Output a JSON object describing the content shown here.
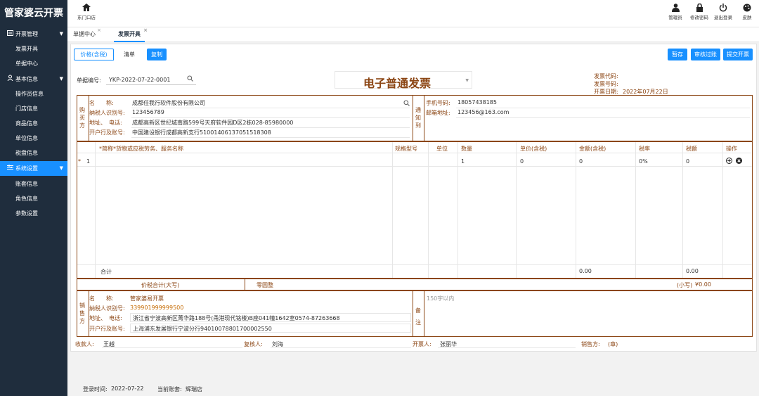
{
  "app": {
    "title": "管家婆云开票"
  },
  "sidebar": {
    "groups": [
      {
        "label": "开票管理",
        "icon": "invoice-icon",
        "items": [
          "发票开具",
          "单据中心"
        ]
      },
      {
        "label": "基本信息",
        "icon": "user-icon",
        "items": [
          "操作员信息",
          "门店信息",
          "商品信息",
          "单位信息",
          "税盘信息"
        ]
      },
      {
        "label": "系统设置",
        "icon": "settings-icon",
        "items": [
          "账套信息",
          "角色信息",
          "参数设置"
        ]
      }
    ]
  },
  "header": {
    "home_label": "东门口店",
    "actions": [
      {
        "label": "管理员",
        "icon": "admin-icon"
      },
      {
        "label": "修改密码",
        "icon": "lock-icon"
      },
      {
        "label": "退出登录",
        "icon": "power-icon"
      },
      {
        "label": "皮肤",
        "icon": "palette-icon"
      }
    ]
  },
  "tabs": [
    {
      "label": "单据中心",
      "close": "×"
    },
    {
      "label": "发票开具",
      "close": "×"
    }
  ],
  "toolbar": {
    "price_tax": "价格(含税)",
    "list": "清单",
    "copy": "复制",
    "save": "暂存",
    "audit": "审核过账",
    "submit": "提交开票"
  },
  "invoice": {
    "doc_no_label": "单据编号:",
    "doc_no": "YKP-2022-07-22-0001",
    "type": "电子普通发票",
    "code_label": "发票代码:",
    "number_label": "发票号码:",
    "date_label": "开票日期:",
    "date": "2022年07月22日",
    "buyer": {
      "side": [
        "购",
        "买",
        "方"
      ],
      "name_label": "名　　称:",
      "name": "成都任我行软件股份有限公司",
      "tax_label": "纳税人识别号:",
      "tax_id": "123456789",
      "addr_label": "地址、　电话:",
      "addr": "成都高新区世纪城南路599号天府软件园D区2栋028-85980000",
      "bank_label": "开户行及账号:",
      "bank": "中国建设银行成都高新支行51001406137051518308"
    },
    "notify": {
      "side": [
        "通",
        "知",
        "到"
      ],
      "phone_label": "手机号码:",
      "phone": "18057438185",
      "email_label": "邮箱地址:",
      "email": "123456@163.com"
    },
    "table": {
      "headers": [
        "*简称*货物或应税劳务、服务名称",
        "规格型号",
        "单位",
        "数量",
        "单价(含税)",
        "金额(含税)",
        "税率",
        "税额",
        "操作"
      ],
      "rows": [
        {
          "mark": "*",
          "no": "1",
          "qty": "1",
          "price": "0",
          "amount": "0",
          "rate": "0%",
          "tax": "0"
        }
      ],
      "total_label": "合计",
      "total_amount": "0.00",
      "total_tax": "0.00"
    },
    "sum": {
      "label": "价税合计(大写)",
      "upper": "零圆整",
      "lower_label": "(小写)",
      "lower": "¥0.00"
    },
    "seller": {
      "side": [
        "销",
        "售",
        "方"
      ],
      "name_label": "名　　称:",
      "name": "管家婆易开票",
      "tax_label": "纳税人识别号:",
      "tax_id": "339901999999500",
      "addr_label": "地址、　电话:",
      "addr": "浙江省宁波高新区菁华路188号(甬港现代铭楼)B座041幢1642室0574-87263668",
      "bank_label": "开户行及账号:",
      "bank": "上海浦东发展银行宁波分行94010078801700002550"
    },
    "remark": {
      "side": [
        "备",
        "注"
      ],
      "placeholder": "150字以内"
    },
    "signers": {
      "payee_label": "收款人:",
      "payee": "王越",
      "reviewer_label": "复核人:",
      "reviewer": "刘海",
      "drawer_label": "开票人:",
      "drawer": "张丽华",
      "seller_label": "销售方:",
      "seller": "(章)"
    }
  },
  "footer": {
    "login_label": "登录时间:",
    "login_time": "2022-07-22",
    "account_label": "当前账套:",
    "account": "辉瑞店"
  },
  "colors": {
    "accent": "#1890ff",
    "invoice_brown": "#8b4513",
    "sidebar": "#1f2d3d"
  }
}
